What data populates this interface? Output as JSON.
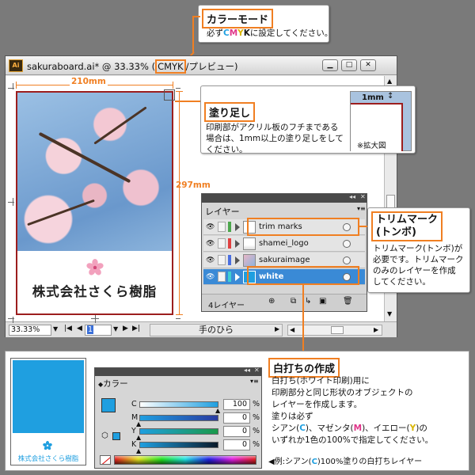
{
  "colors": {
    "accent_orange": "#f07f22",
    "cyan": "#1f9fe0",
    "layer_selected": "#3a8ad6",
    "trim_red": "#9c1e1e"
  },
  "callout_colormode": {
    "title": "カラーモード",
    "text_pre": "必ず",
    "c": "C",
    "m": "M",
    "y": "Y",
    "k": "K",
    "text_post": "に設定してください。"
  },
  "window": {
    "title_prefix": "sakuraboard.ai* @ 33.33% (",
    "title_mode": "CMYK",
    "title_suffix": "/プレビュー)",
    "minimize_icon": "minimize-icon",
    "maximize_icon": "maximize-icon",
    "close_icon": "close-icon",
    "zoom": "33.33%",
    "page_number": "1",
    "tool_label": "手のひら"
  },
  "artboard": {
    "company_name": "株式会社さくら樹脂",
    "width_label": "210mm",
    "height_label": "297mm"
  },
  "callout_bleed": {
    "title": "塗り足し",
    "line1": "印刷部がアクリル板のフチまである",
    "line2": "場合は、1mm以上の塗り足しをして",
    "line3": "ください。",
    "detail_1mm": "1mm",
    "detail_caption": "※拡大図"
  },
  "layers_panel": {
    "tab": "レイヤー",
    "footer_count": "4レイヤー",
    "layers": [
      {
        "name": "trim marks",
        "chip": "#4ca64c"
      },
      {
        "name": "shamei_logo",
        "chip": "#e04040"
      },
      {
        "name": "sakuraimage",
        "chip": "#4a6ee0"
      },
      {
        "name": "white",
        "chip": "#40d0d0"
      }
    ]
  },
  "callout_trim": {
    "title_line1": "トリムマーク",
    "title_line2": "(トンボ)",
    "line1": "トリムマーク(トンボ)が",
    "line2": "必要です。トリムマーク",
    "line3": "のみのレイヤーを作成",
    "line4": "してください。"
  },
  "callout_white": {
    "title": "白打ちの作成",
    "line1": "白打ち(ホワイト印刷)用に",
    "line2": "印刷部分と同じ形状のオブジェクトの",
    "line3": "レイヤーを作成します。",
    "line4": "塗りは必ず",
    "line5a": "シアン(",
    "line5_c": "C",
    "line5b": ")、マゼンタ(",
    "line5_m": "M",
    "line5c": ")、イエロー(",
    "line5_y": "Y",
    "line5d": ")の",
    "line6": "いずれか1色の100%で指定してください。"
  },
  "example_caption": {
    "prefix": "◀例:シアン(",
    "c": "C",
    "suffix": ")100%塗りの白打ちレイヤー"
  },
  "preview_card": {
    "company_name": "株式会社さくら樹脂"
  },
  "color_panel": {
    "title": "カラー",
    "channels": [
      {
        "label": "C",
        "value": "100",
        "unit": "%"
      },
      {
        "label": "M",
        "value": "0",
        "unit": "%"
      },
      {
        "label": "Y",
        "value": "0",
        "unit": "%"
      },
      {
        "label": "K",
        "value": "0",
        "unit": "%"
      }
    ]
  }
}
